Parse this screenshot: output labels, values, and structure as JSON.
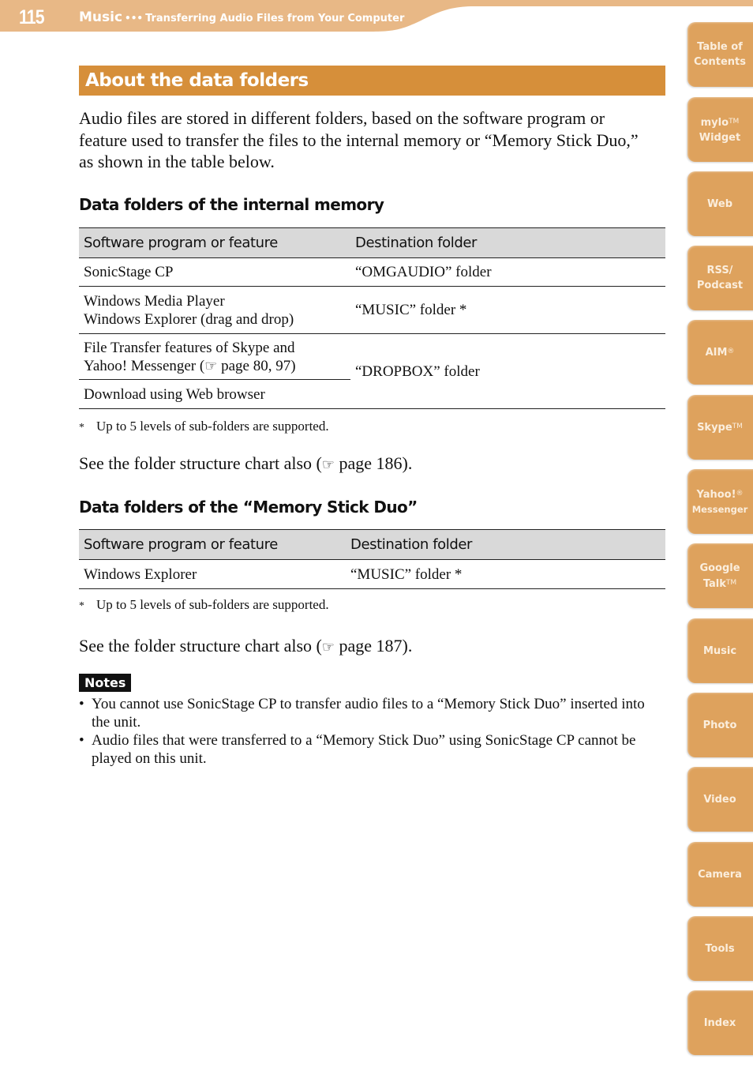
{
  "header": {
    "page_number": "115",
    "section": "Music",
    "separator": "•••",
    "subsection": "Transferring Audio Files from Your Computer"
  },
  "side_tabs": [
    {
      "line1": "Table of",
      "line2": "Contents",
      "mark": ""
    },
    {
      "line1": "mylo",
      "mark1": "TM",
      "line2": "Widget"
    },
    {
      "line1": "Web",
      "line2": ""
    },
    {
      "line1": "RSS/",
      "line2": "Podcast"
    },
    {
      "line1": "AIM",
      "mark1": "®",
      "line2": ""
    },
    {
      "line1": "Skype",
      "mark1": "TM",
      "line2": ""
    },
    {
      "line1": "Yahoo!",
      "mark1": "®",
      "line2": "Messenger"
    },
    {
      "line1": "Google",
      "line2": "Talk",
      "mark2": "TM"
    },
    {
      "line1": "Music",
      "line2": ""
    },
    {
      "line1": "Photo",
      "line2": ""
    },
    {
      "line1": "Video",
      "line2": ""
    },
    {
      "line1": "Camera",
      "line2": ""
    },
    {
      "line1": "Tools",
      "line2": ""
    },
    {
      "line1": "Index",
      "line2": ""
    }
  ],
  "title": "About the data folders",
  "intro": "Audio files are stored in different folders, based on the software program or feature used to transfer the files to the internal memory or “Memory Stick Duo,” as shown in the table below.",
  "internal": {
    "heading": "Data folders of the internal memory",
    "columns": [
      "Software program or feature",
      "Destination folder"
    ],
    "rows": [
      {
        "program": "SonicStage CP",
        "folder": "“OMGAUDIO” folder"
      },
      {
        "program_line1": "Windows Media Player",
        "program_line2": "Windows Explorer (drag and drop)",
        "folder": "“MUSIC” folder *"
      },
      {
        "program_line1": "File Transfer features of Skype and",
        "program_line2_pre": "Yahoo! Messenger (",
        "ref_icon": "☞",
        "program_line2_post": " page 80, 97)",
        "folder": "“DROPBOX” folder"
      },
      {
        "program": "Download using Web browser"
      }
    ],
    "footnote_mark": "*",
    "footnote": "Up to 5 levels of sub-folders are supported.",
    "see_pre": "See the folder structure chart also (",
    "see_icon": "☞",
    "see_post": " page 186)."
  },
  "memory_stick": {
    "heading": "Data folders of the “Memory Stick Duo”",
    "columns": [
      "Software program or feature",
      "Destination folder"
    ],
    "rows": [
      {
        "program": "Windows Explorer",
        "folder": "“MUSIC” folder *"
      }
    ],
    "footnote_mark": "*",
    "footnote": "Up to 5 levels of sub-folders are supported.",
    "see_pre": "See the folder structure chart also (",
    "see_icon": "☞",
    "see_post": " page 187)."
  },
  "notes": {
    "label": "Notes",
    "bullet": "•",
    "items": [
      "You cannot use SonicStage CP to transfer audio files to a “Memory Stick Duo” inserted into the unit.",
      "Audio files that were transferred to a “Memory Stick Duo” using SonicStage CP cannot be played on this unit."
    ]
  }
}
